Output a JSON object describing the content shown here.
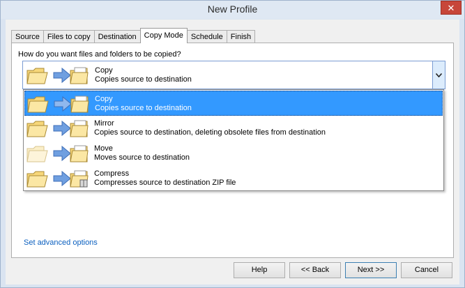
{
  "window": {
    "title": "New Profile",
    "close_glyph": "✕"
  },
  "tabs": [
    {
      "label": "Source",
      "active": false
    },
    {
      "label": "Files to copy",
      "active": false
    },
    {
      "label": "Destination",
      "active": false
    },
    {
      "label": "Copy Mode",
      "active": true
    },
    {
      "label": "Schedule",
      "active": false
    },
    {
      "label": "Finish",
      "active": false
    }
  ],
  "panel": {
    "question": "How do you want files and folders to be copied?",
    "combo": {
      "selected_title": "Copy",
      "selected_desc": "Copies source to destination",
      "arrow_icon": "chevron-down-icon"
    },
    "options": [
      {
        "title": "Copy",
        "desc": "Copies source to destination",
        "selected": true,
        "icon": "copy-mode-icon"
      },
      {
        "title": "Mirror",
        "desc": "Copies source to destination, deleting obsolete files from destination",
        "selected": false,
        "icon": "mirror-mode-icon"
      },
      {
        "title": "Move",
        "desc": "Moves source to destination",
        "selected": false,
        "icon": "move-mode-icon"
      },
      {
        "title": "Compress",
        "desc": "Compresses source to destination ZIP file",
        "selected": false,
        "icon": "compress-mode-icon"
      }
    ],
    "advanced_link": "Set advanced options"
  },
  "buttons": {
    "help": "Help",
    "back": "<< Back",
    "next": "Next >>",
    "cancel": "Cancel"
  },
  "colors": {
    "selection": "#3399ff",
    "folder": "#f7d77a",
    "arrow": "#6f9fe0",
    "link": "#0a5fbf"
  }
}
